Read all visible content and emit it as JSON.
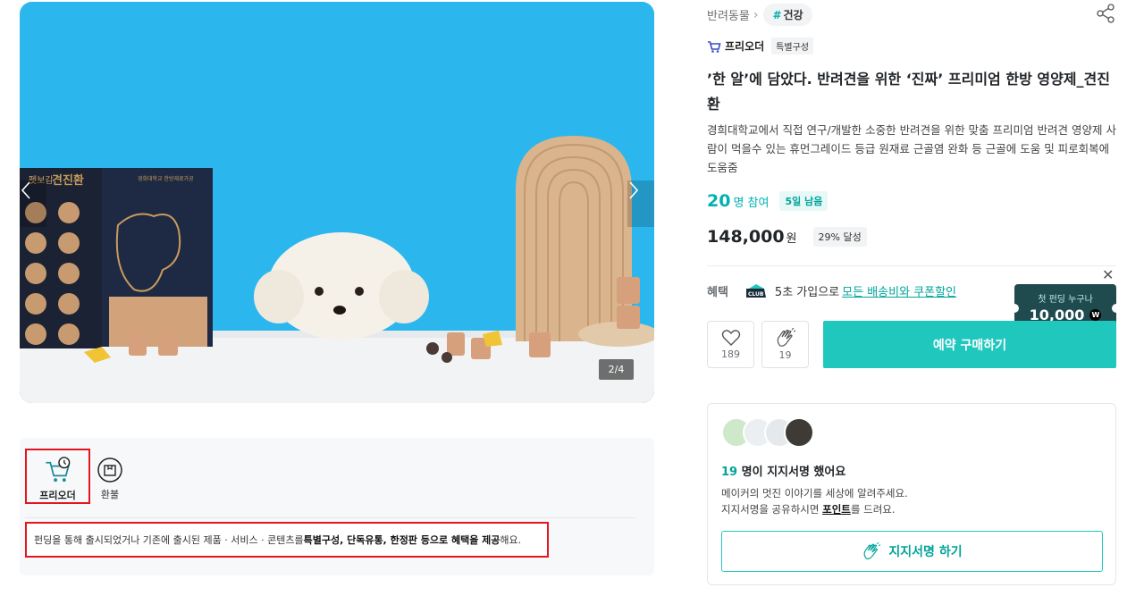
{
  "hero": {
    "counter": "2/4",
    "box_label_left": "견진환",
    "box_brand_left": "펫보감",
    "box_caption_right": "경희대학교 한방재료가공"
  },
  "info_card": {
    "tabs": [
      {
        "label": "프리오더",
        "icon": "cart-clock-icon"
      },
      {
        "label": "환불",
        "icon": "refund-box-icon"
      }
    ],
    "text_1": "펀딩을 통해 출시되었거나 기존에 출시된 제품 · 서비스 · 콘텐츠를 ",
    "text_b1": "특별구성, 단독유통, 한정판 등으로 혜택을 제공",
    "text_2": "해요."
  },
  "product": {
    "breadcrumb": "반려동물",
    "tag_hash": "#",
    "tag": "건강",
    "preorder_label": "프리오더",
    "preorder_badge": "특별구성",
    "title": "’한 알’에 담았다. 반려견을 위한 ‘진짜’ 프리미엄 한방 영양제_견진환",
    "description": "경희대학교에서 직접 연구/개발한 소중한 반려견을 위한 맞춤 프리미엄 반려견 영양제 사람이 먹을수 있는 휴먼그레이드 등급 원재료 근골염 완화 등 근골에 도움 및 피로회복에 도움줌",
    "participants": "20",
    "participants_unit": "명 참여",
    "days_left": "5일 남음",
    "price": "148,000",
    "price_unit": "원",
    "achievement": "29% 달성"
  },
  "benefit": {
    "label": "혜택",
    "club": "CLUB",
    "text": "5초 가입으로",
    "link": "모든 배송비와 쿠폰할인"
  },
  "coupon": {
    "top": "첫 펀딩 누구나",
    "value": "10,000",
    "won": "W"
  },
  "actions": {
    "like_count": "189",
    "clap_count": "19",
    "buy_label": "예약 구매하기"
  },
  "support": {
    "count": "19",
    "title_rest": " 명이 지지서명 했어요",
    "line1": "메이커의 멋진 이야기를 세상에 알려주세요.",
    "line2_a": "지지서명을 공유하시면 ",
    "line2_b": "포인트",
    "line2_c": "를 드려요.",
    "button": "지지서명 하기"
  },
  "colors": {
    "accent": "#1fc7bd",
    "accent_text": "#00a49a",
    "highlight_border": "#e3161e",
    "hero_bg": "#2bb7ee",
    "coupon_bg": "#1f4b4f"
  }
}
